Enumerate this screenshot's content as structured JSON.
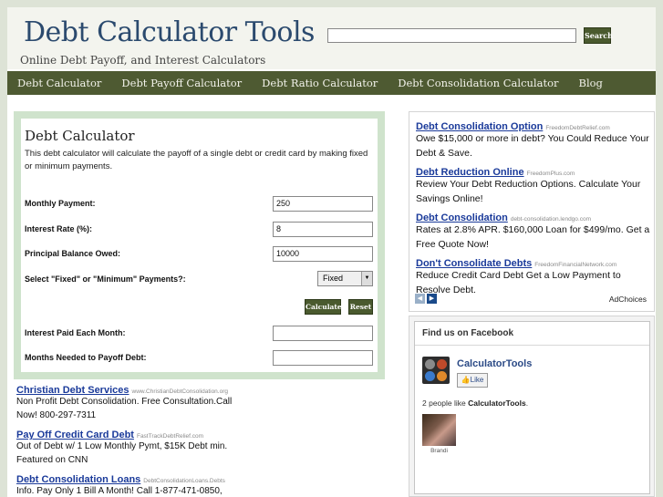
{
  "header": {
    "title": "Debt Calculator Tools",
    "tagline": "Online Debt Payoff, and Interest Calculators",
    "search_value": "",
    "search_button": "Search"
  },
  "nav": [
    "Debt Calculator",
    "Debt Payoff Calculator",
    "Debt Ratio Calculator",
    "Debt Consolidation Calculator",
    "Blog"
  ],
  "calculator": {
    "title": "Debt Calculator",
    "description": "This debt calculator will calculate the payoff of a single debt or credit card by making fixed or minimum payments.",
    "monthly_payment_label": "Monthly Payment:",
    "monthly_payment_value": "250",
    "interest_rate_label": "Interest Rate (%):",
    "interest_rate_value": "8",
    "principal_label": "Principal Balance Owed:",
    "principal_value": "10000",
    "payment_type_label": "Select \"Fixed\" or \"Minimum\" Payments?:",
    "payment_type_value": "Fixed",
    "calculate_button": "Calculate",
    "reset_button": "Reset",
    "interest_paid_label": "Interest Paid Each Month:",
    "interest_paid_value": "",
    "months_label": "Months Needed to Payoff Debt:",
    "months_value": ""
  },
  "ads_left": [
    {
      "title": "Christian Debt Services",
      "url": "www.ChristianDebtConsolidation.org",
      "text": "Non Profit Debt Consolidation. Free Consultation.Call Now! 800-297-7311"
    },
    {
      "title": "Pay Off Credit Card Debt",
      "url": "FastTrackDebtRelief.com",
      "text": "Out of Debt w/ 1 Low Monthly Pymt, $15K Debt min. Featured on CNN"
    },
    {
      "title": "Debt Consolidation Loans",
      "url": "DebtConsolidationLoans.Debts",
      "text": "Info. Pay Only 1 Bill A Month! Call 1-877-471-0850,"
    }
  ],
  "ads_right": [
    {
      "title": "Debt Consolidation Option",
      "url": "FreedomDebtRelief.com",
      "text": "Owe $15,000 or more in debt? You Could Reduce Your Debt & Save."
    },
    {
      "title": "Debt Reduction Online",
      "url": "FreedomPlus.com",
      "text": "Review Your Debt Reduction Options. Calculate Your Savings Online!"
    },
    {
      "title": "Debt Consolidation",
      "url": "debt-consolidation.lendgo.com",
      "text": "Rates at 2.8% APR. $160,000 Loan for $499/mo. Get a Free Quote Now!"
    },
    {
      "title": "Don't Consolidate Debts",
      "url": "FreedomFinancialNetwork.com",
      "text": "Reduce Credit Card Debt Get a Low Payment to Resolve Debt."
    }
  ],
  "adchoices": "AdChoices",
  "ad_nav": {
    "prev_icon": "chevron-left-icon",
    "next_icon": "chevron-right-icon",
    "prev_glyph": "◀",
    "next_glyph": "▶"
  },
  "facebook": {
    "header": "Find us on Facebook",
    "page_name": "CalculatorTools",
    "like_label": "Like",
    "count_prefix": "2 people like ",
    "count_name": "CalculatorTools",
    "count_suffix": ".",
    "fan_name": "Brandi"
  },
  "colors": {
    "nav_bg": "#4e5a32",
    "title_blue": "#2b4a6e",
    "ad_link": "#1a3a9a",
    "calc_border": "#cfe3cc"
  }
}
